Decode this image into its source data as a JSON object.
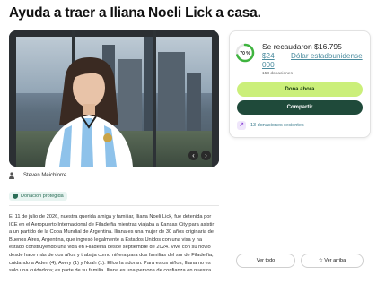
{
  "page": {
    "title": "Ayuda a traer a Iliana Noeli Lick a casa."
  },
  "organizer": {
    "name": "Steven Meichiorre"
  },
  "badge": {
    "label": "Donación protegida"
  },
  "story": {
    "text": "El 11 de julio de 2026, nuestra querida amiga y familiar, Iliana Noeli Lick, fue detenida por ICE en el Aeropuerto Internacional de Filadelfia mientras viajaba a Kansas City para asistir a un partido de la Copa Mundial de Argentina. Iliana es una mujer de 30 años originaria de Buenos Aires, Argentina, que ingresó legalmente a Estados Unidos con una visa y ha estado construyendo una vida en Filadelfia desde septiembre de 2024. Vive con su novio desde hace más de dos años y trabaja como niñera para dos familias del sur de Filadelfia, cuidando a Aiden (4), Avery (1) y Noah (1). Ellos la adoran. Para estos niños, Iliana no es solo una cuidadora; es parte de su familia. Iliana es una persona de confianza en nuestra"
  },
  "fundraiser": {
    "percent_label": "70 %",
    "percent": 70,
    "raised": "Se recaudaron $16.795",
    "goal_amount": "$24 000",
    "goal_currency": "Dólar estadounidense",
    "donations_count": "158 donaciones",
    "donate_label": "Dona ahora",
    "share_label": "Compartir",
    "recent_label": "13 donaciones recientes"
  },
  "actions": {
    "see_all": "Ver todo",
    "see_top": "Ver arriba"
  },
  "colors": {
    "donate": "#cbef7a",
    "share": "#1f4a3a",
    "progress": "#3fb43f"
  }
}
